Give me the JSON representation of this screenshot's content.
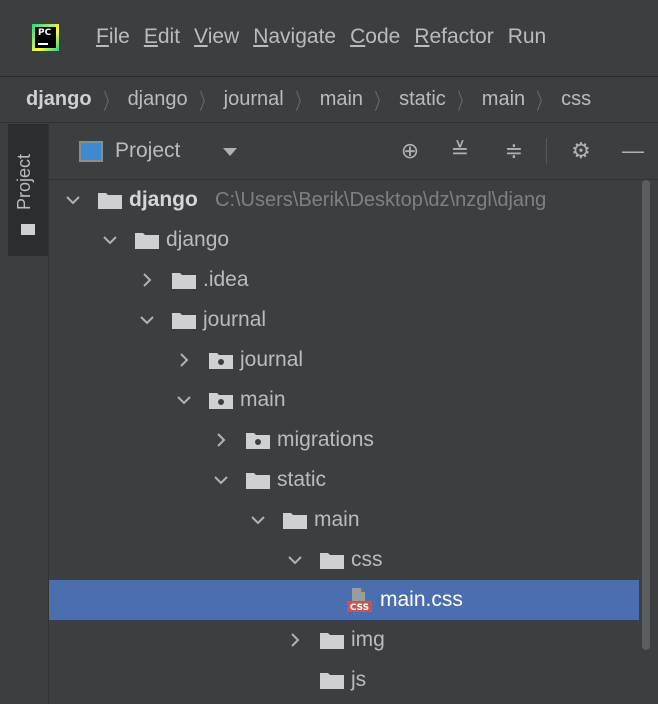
{
  "app": {
    "logo_text": "PC"
  },
  "menu": {
    "items": [
      {
        "mnemonic": "F",
        "rest": "ile"
      },
      {
        "mnemonic": "E",
        "rest": "dit"
      },
      {
        "mnemonic": "V",
        "rest": "iew"
      },
      {
        "mnemonic": "N",
        "rest": "avigate"
      },
      {
        "mnemonic": "C",
        "rest": "ode"
      },
      {
        "mnemonic": "R",
        "rest": "efactor"
      },
      {
        "mnemonic": "",
        "rest": "Run"
      }
    ]
  },
  "breadcrumb": {
    "items": [
      "django",
      "django",
      "journal",
      "main",
      "static",
      "main",
      "css"
    ]
  },
  "left_strip": {
    "tab_label": "Project"
  },
  "panel": {
    "title": "Project",
    "tools": {
      "locate": "⊕",
      "expand_all": "≚",
      "collapse_all": "≑",
      "settings": "⚙",
      "hide": "—"
    }
  },
  "tree": {
    "rows": [
      {
        "label": "django",
        "path": "C:\\Users\\Berik\\Desktop\\dz\\nzgl\\djang",
        "bold": true,
        "expanded": true,
        "kind": "folder"
      },
      {
        "label": "django",
        "expanded": true,
        "kind": "folder"
      },
      {
        "label": ".idea",
        "expanded": false,
        "kind": "folder"
      },
      {
        "label": "journal",
        "expanded": true,
        "kind": "folder"
      },
      {
        "label": "journal",
        "expanded": false,
        "kind": "package"
      },
      {
        "label": "main",
        "expanded": true,
        "kind": "package"
      },
      {
        "label": "migrations",
        "expanded": false,
        "kind": "package"
      },
      {
        "label": "static",
        "expanded": true,
        "kind": "folder"
      },
      {
        "label": "main",
        "expanded": true,
        "kind": "folder"
      },
      {
        "label": "css",
        "expanded": true,
        "kind": "folder"
      },
      {
        "label": "main.css",
        "kind": "css-file",
        "selected": true
      },
      {
        "label": "img",
        "expanded": false,
        "kind": "folder"
      },
      {
        "label": "js",
        "kind": "folder"
      }
    ]
  },
  "colors": {
    "background": "#3c3f41",
    "selection": "#4b6eaf",
    "text": "#bbbbbb",
    "path_text": "#808080",
    "folder": "#cfd0d1",
    "css_badge": "#c75450"
  }
}
